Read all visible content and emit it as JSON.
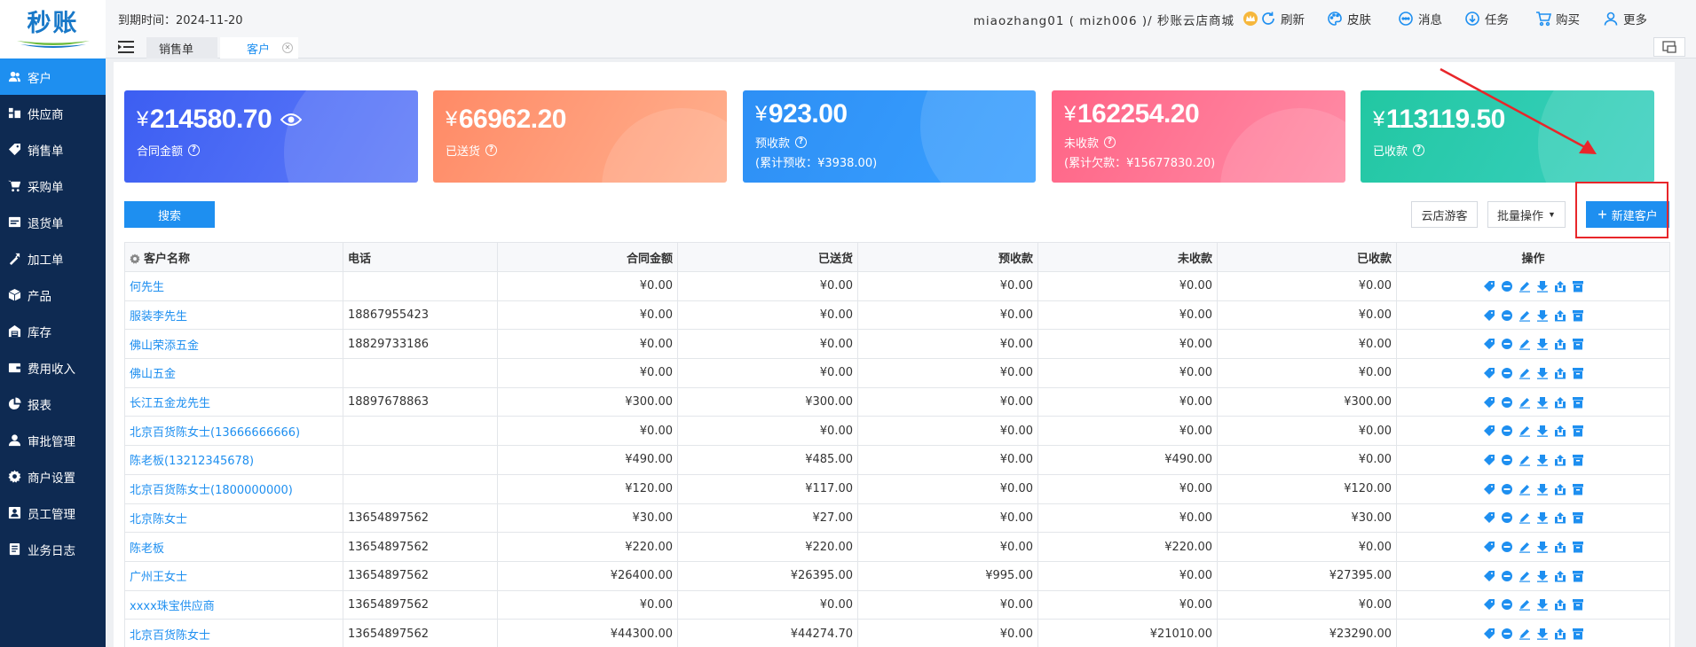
{
  "brand": {
    "logo_text": "秒账"
  },
  "header": {
    "expire": "到期时间：2024-11-20",
    "account": "miaozhang01 ( mizh006 )/ 秒账云店商城",
    "buttons": [
      {
        "label": "刷新",
        "icon": "refresh-icon"
      },
      {
        "label": "皮肤",
        "icon": "palette-icon"
      },
      {
        "label": "消息",
        "icon": "message-icon"
      },
      {
        "label": "任务",
        "icon": "download-circle-icon"
      },
      {
        "label": "购买",
        "icon": "cart-icon"
      },
      {
        "label": "更多",
        "icon": "user-icon"
      }
    ],
    "tabs": [
      {
        "label": "销售单"
      },
      {
        "label": "客户"
      }
    ]
  },
  "sidebar": {
    "items": [
      {
        "label": "客户",
        "icon": "users-icon",
        "active": true
      },
      {
        "label": "供应商",
        "icon": "supplier-icon"
      },
      {
        "label": "销售单",
        "icon": "tag-icon"
      },
      {
        "label": "采购单",
        "icon": "cart-icon"
      },
      {
        "label": "退货单",
        "icon": "return-icon"
      },
      {
        "label": "加工单",
        "icon": "process-icon"
      },
      {
        "label": "产品",
        "icon": "box-icon"
      },
      {
        "label": "库存",
        "icon": "warehouse-icon"
      },
      {
        "label": "费用收入",
        "icon": "wallet-icon"
      },
      {
        "label": "报表",
        "icon": "pie-chart-icon"
      },
      {
        "label": "审批管理",
        "icon": "approval-icon"
      },
      {
        "label": "商户设置",
        "icon": "gear-icon"
      },
      {
        "label": "员工管理",
        "icon": "staff-icon"
      },
      {
        "label": "业务日志",
        "icon": "log-icon"
      }
    ]
  },
  "cards": [
    {
      "amount": "214580.70",
      "label": "合同金额",
      "sub": "",
      "eye": true,
      "color": "#4a6af5"
    },
    {
      "amount": "66962.20",
      "label": "已送货",
      "sub": "",
      "color": "#ff9572"
    },
    {
      "amount": "923.00",
      "label": "预收款",
      "sub": "(累计预收：¥3938.00)",
      "color": "#3097f8"
    },
    {
      "amount": "162254.20",
      "label": "未收款",
      "sub": "(累计欠款：¥15677830.20)",
      "color": "#ff7493"
    },
    {
      "amount": "113119.50",
      "label": "已收款",
      "sub": "",
      "color": "#2acbb0"
    }
  ],
  "currency": "¥",
  "toolbar": {
    "search": "搜索",
    "guest": "云店游客",
    "batch": "批量操作",
    "new_customer": "新建客户"
  },
  "table": {
    "headers": [
      "客户名称",
      "电话",
      "合同金额",
      "已送货",
      "预收款",
      "未收款",
      "已收款",
      "操作"
    ],
    "rows": [
      [
        "何先生",
        "",
        "¥0.00",
        "¥0.00",
        "¥0.00",
        "¥0.00",
        "¥0.00"
      ],
      [
        "服装李先生",
        "18867955423",
        "¥0.00",
        "¥0.00",
        "¥0.00",
        "¥0.00",
        "¥0.00"
      ],
      [
        "佛山荣添五金",
        "18829733186",
        "¥0.00",
        "¥0.00",
        "¥0.00",
        "¥0.00",
        "¥0.00"
      ],
      [
        "佛山五金",
        "",
        "¥0.00",
        "¥0.00",
        "¥0.00",
        "¥0.00",
        "¥0.00"
      ],
      [
        "长江五金龙先生",
        "18897678863",
        "¥300.00",
        "¥300.00",
        "¥0.00",
        "¥0.00",
        "¥300.00"
      ],
      [
        "北京百货陈女士(13666666666)",
        "",
        "¥0.00",
        "¥0.00",
        "¥0.00",
        "¥0.00",
        "¥0.00"
      ],
      [
        "陈老板(13212345678)",
        "",
        "¥490.00",
        "¥485.00",
        "¥0.00",
        "¥490.00",
        "¥0.00"
      ],
      [
        "北京百货陈女士(1800000000)",
        "",
        "¥120.00",
        "¥117.00",
        "¥0.00",
        "¥0.00",
        "¥120.00"
      ],
      [
        "北京陈女士",
        "13654897562",
        "¥30.00",
        "¥27.00",
        "¥0.00",
        "¥0.00",
        "¥30.00"
      ],
      [
        "陈老板",
        "13654897562",
        "¥220.00",
        "¥220.00",
        "¥0.00",
        "¥220.00",
        "¥0.00"
      ],
      [
        "广州王女士",
        "13654897562",
        "¥26400.00",
        "¥26395.00",
        "¥995.00",
        "¥0.00",
        "¥27395.00"
      ],
      [
        "xxxx珠宝供应商",
        "13654897562",
        "¥0.00",
        "¥0.00",
        "¥0.00",
        "¥0.00",
        "¥0.00"
      ],
      [
        "北京百货陈女士",
        "13654897562",
        "¥44300.00",
        "¥44274.70",
        "¥0.00",
        "¥21010.00",
        "¥23290.00"
      ]
    ],
    "row_actions": [
      "tag-icon",
      "minus-circle-icon",
      "edit-icon",
      "download-icon",
      "share-icon",
      "archive-icon"
    ]
  },
  "colors": {
    "accent": "#1e8ff0",
    "sidebar": "#0e2a52",
    "highlight": "#e8262a"
  }
}
